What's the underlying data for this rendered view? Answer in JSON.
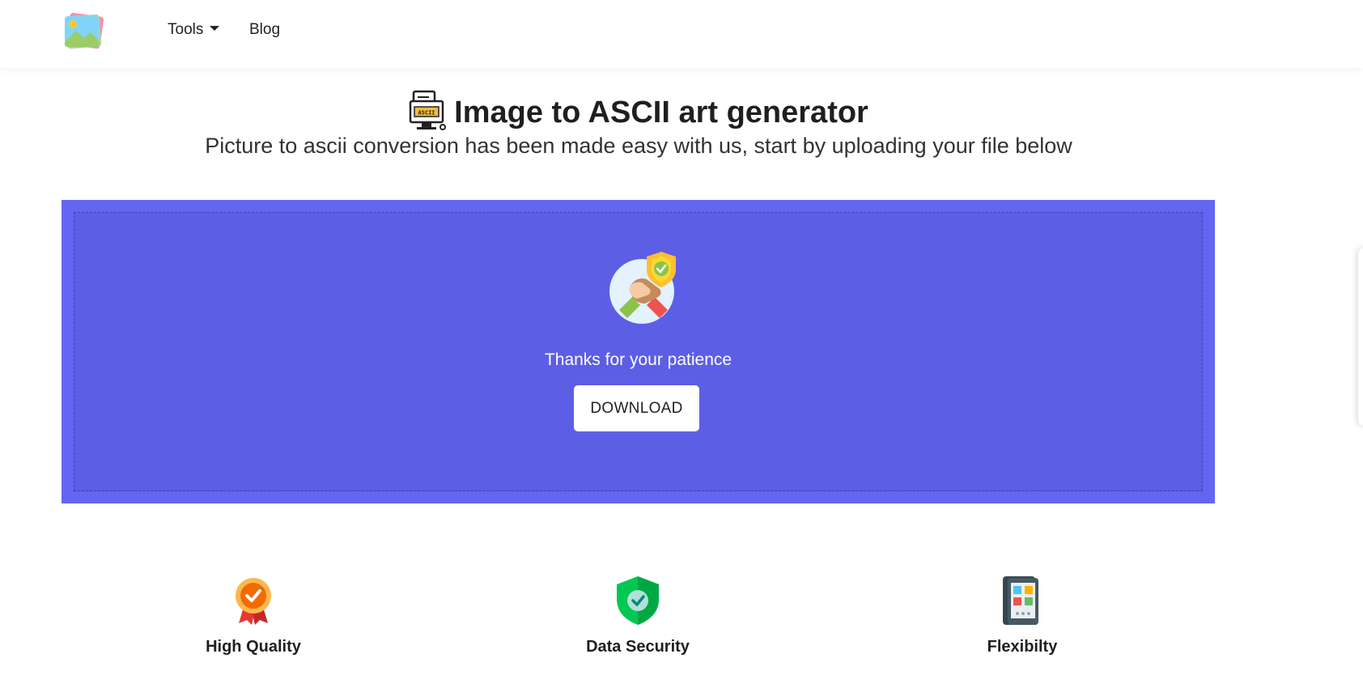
{
  "nav": {
    "logo_icon": "image-stack-icon",
    "tools_label": "Tools",
    "blog_label": "Blog"
  },
  "header": {
    "title_icon": "ascii-monitor-icon",
    "title": "Image to ASCII art generator",
    "subtitle": "Picture to ascii conversion has been made easy with us, start by uploading your file below"
  },
  "panel": {
    "bg_color": "#6266f1",
    "icon": "handshake-shield-icon",
    "message": "Thanks for your patience",
    "download_label": "DOWNLOAD"
  },
  "features": [
    {
      "icon": "award-badge-icon",
      "label": "High Quality"
    },
    {
      "icon": "shield-check-icon",
      "label": "Data Security"
    },
    {
      "icon": "device-grid-icon",
      "label": "Flexibilty"
    }
  ]
}
